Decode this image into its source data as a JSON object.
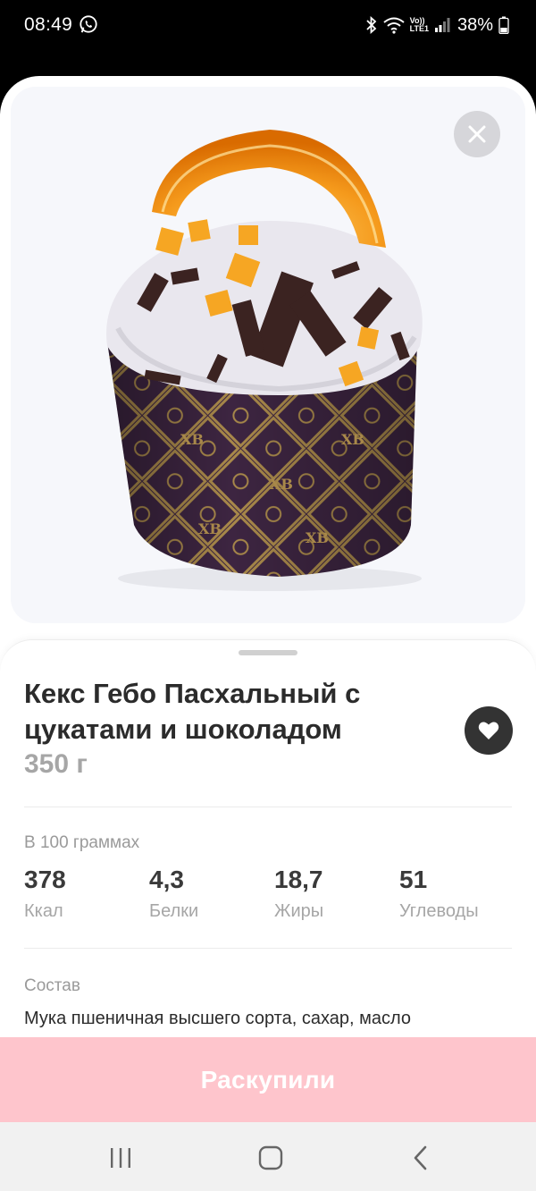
{
  "status_bar": {
    "time": "08:49",
    "battery": "38%",
    "volte_top": "Vo))",
    "volte_bottom": "LTE1",
    "icons": [
      "whatsapp-icon",
      "bluetooth-icon",
      "wifi-icon",
      "signal-icon",
      "battery-icon"
    ]
  },
  "product": {
    "title": "Кекс Гебо Пасхальный с цукатами и шоколадом",
    "weight": "350 г",
    "wrapper_text": "ХВ"
  },
  "nutrition": {
    "section_label": "В 100 граммах",
    "items": [
      {
        "value": "378",
        "label": "Ккал"
      },
      {
        "value": "4,3",
        "label": "Белки"
      },
      {
        "value": "18,7",
        "label": "Жиры"
      },
      {
        "value": "51",
        "label": "Углеводы"
      }
    ]
  },
  "composition": {
    "section_label": "Состав",
    "text": "Мука пшеничная высшего сорта, сахар, масло"
  },
  "action": {
    "label": "Раскупили",
    "color": "#fec5cc"
  },
  "colors": {
    "favorite_bg": "#333333",
    "text": "#2b2b2b",
    "muted": "#a6a6a6"
  }
}
